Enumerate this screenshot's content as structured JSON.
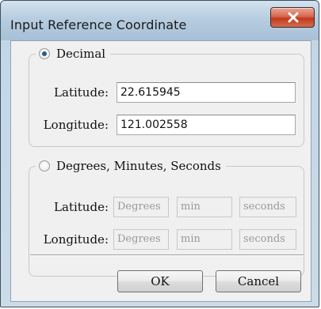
{
  "window": {
    "title": "Input Reference Coordinate",
    "close_label": "×"
  },
  "decimal": {
    "label": "Decimal",
    "selected": true,
    "latitude_label": "Latitude:",
    "latitude_value": "22.615945",
    "longitude_label": "Longitude:",
    "longitude_value": "121.002558"
  },
  "dms": {
    "label": "Degrees, Minutes, Seconds",
    "selected": false,
    "latitude_label": "Latitude:",
    "longitude_label": "Longitude:",
    "degrees_placeholder": "Degrees",
    "minutes_placeholder": "min",
    "seconds_placeholder": "seconds"
  },
  "buttons": {
    "ok_label": "OK",
    "cancel_label": "Cancel"
  },
  "colors": {
    "titlebar": "#b7cde0",
    "close_button": "#c23a1f",
    "radio_dot": "#2c5a86"
  }
}
